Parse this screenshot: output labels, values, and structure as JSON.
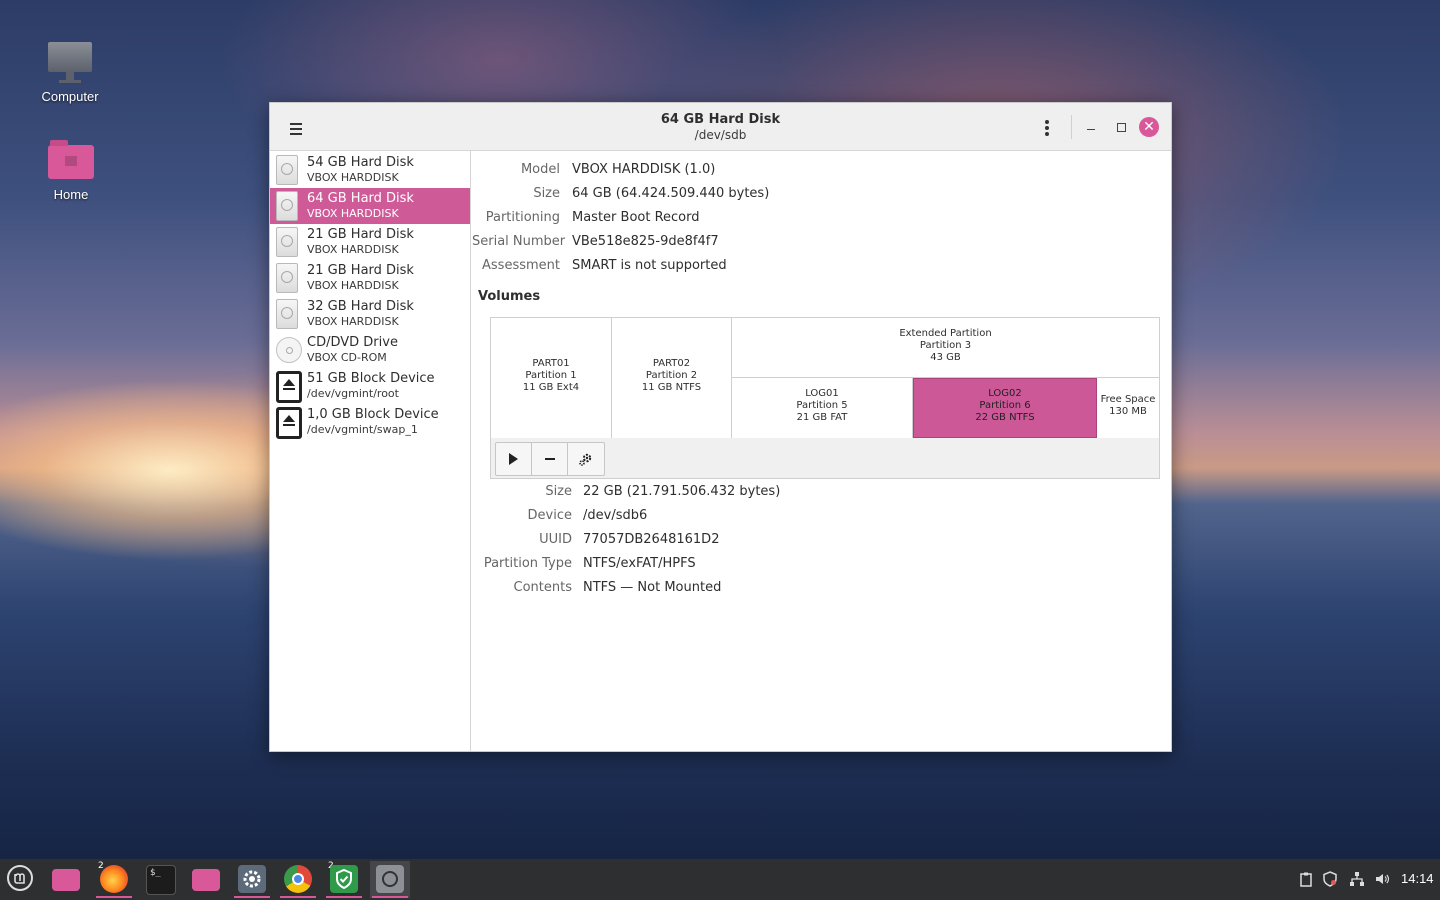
{
  "desktop": {
    "icons": [
      {
        "label": "Computer"
      },
      {
        "label": "Home"
      }
    ]
  },
  "window": {
    "title": "64 GB Hard Disk",
    "subtitle": "/dev/sdb"
  },
  "sidebar": {
    "items": [
      {
        "name": "54 GB Hard Disk",
        "sub": "VBOX HARDDISK",
        "icon": "hard-disk-icon"
      },
      {
        "name": "64 GB Hard Disk",
        "sub": "VBOX HARDDISK",
        "icon": "hard-disk-icon",
        "selected": true
      },
      {
        "name": "21 GB Hard Disk",
        "sub": "VBOX HARDDISK",
        "icon": "hard-disk-icon"
      },
      {
        "name": "21 GB Hard Disk",
        "sub": "VBOX HARDDISK",
        "icon": "hard-disk-icon"
      },
      {
        "name": "32 GB Hard Disk",
        "sub": "VBOX HARDDISK",
        "icon": "hard-disk-icon"
      },
      {
        "name": "CD/DVD Drive",
        "sub": "VBOX CD-ROM",
        "icon": "optical-drive-icon"
      },
      {
        "name": "51 GB Block Device",
        "sub": "/dev/vgmint/root",
        "icon": "block-device-icon"
      },
      {
        "name": "1,0 GB Block Device",
        "sub": "/dev/vgmint/swap_1",
        "icon": "block-device-icon"
      }
    ]
  },
  "disk": {
    "model_label": "Model",
    "model": "VBOX HARDDISK (1.0)",
    "size_label": "Size",
    "size": "64 GB (64.424.509.440 bytes)",
    "partitioning_label": "Partitioning",
    "partitioning": "Master Boot Record",
    "serial_label": "Serial Number",
    "serial": "VBe518e825-9de8f4f7",
    "assessment_label": "Assessment",
    "assessment": "SMART is not supported"
  },
  "volumes": {
    "heading": "Volumes",
    "part01": {
      "l1": "PART01",
      "l2": "Partition 1",
      "l3": "11 GB Ext4"
    },
    "part02": {
      "l1": "PART02",
      "l2": "Partition 2",
      "l3": "11 GB NTFS"
    },
    "extended": {
      "l1": "Extended Partition",
      "l2": "Partition 3",
      "l3": "43 GB"
    },
    "log01": {
      "l1": "LOG01",
      "l2": "Partition 5",
      "l3": "21 GB FAT"
    },
    "log02": {
      "l1": "LOG02",
      "l2": "Partition 6",
      "l3": "22 GB NTFS"
    },
    "free": {
      "l1": "Free Space",
      "l2": "130 MB"
    }
  },
  "partition": {
    "size_label": "Size",
    "size": "22 GB (21.791.506.432 bytes)",
    "device_label": "Device",
    "device": "/dev/sdb6",
    "uuid_label": "UUID",
    "uuid": "77057DB2648161D2",
    "type_label": "Partition Type",
    "type": "NTFS/exFAT/HPFS",
    "contents_label": "Contents",
    "contents": "NTFS — Not Mounted"
  },
  "taskbar": {
    "badges": {
      "firefox": "2",
      "shield": "2"
    },
    "clock": "14:14"
  },
  "colors": {
    "accent": "#cf5a98"
  }
}
